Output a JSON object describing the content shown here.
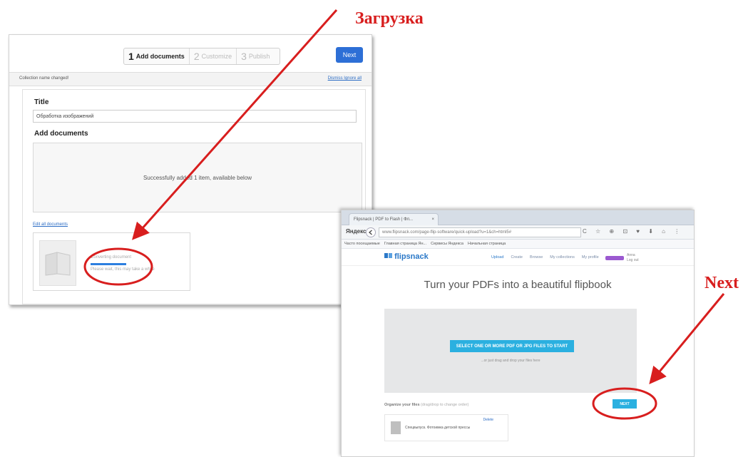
{
  "annotations": {
    "upload_label": "Загрузка",
    "next_label": "Next",
    "color": "#d81e1e"
  },
  "left_app": {
    "steps": [
      {
        "number": "1",
        "label": "Add documents"
      },
      {
        "number": "2",
        "label": "Customize"
      },
      {
        "number": "3",
        "label": "Publish"
      }
    ],
    "next_button": "Next",
    "notice": "Collection name changed!",
    "notice_links": "Dismiss  Ignore all",
    "title_heading": "Title",
    "title_value": "Обработка изображений",
    "add_documents_heading": "Add documents",
    "dropzone_message": "Successfully added 1 item, available below",
    "edit_all_link": "Edit all documents",
    "document": {
      "name": "Converting document",
      "status": "Please wait, this may take a while",
      "progress_fraction": 0.5
    },
    "accent_color": "#2d6fd6"
  },
  "right_app": {
    "browser_tab_title": "Flipsnack | PDF to Flash | Фл...",
    "browser_tab_close": "×",
    "browser_logo": "Яндекс",
    "back_icon": "back-arrow-icon",
    "address": "www.flipsnack.com/page-flip-software/quick-upload?u=1&ch=html5#",
    "nav_icons": "C ☆ ⊕ ⊡ ♥ ⬇ ⌂ ⋮",
    "bookmarks": [
      "Часто посещаемые",
      "Главная страница Ян...",
      "Сервисы Яндекса",
      "Начальная страница"
    ],
    "logo": "flipsnack",
    "menu": [
      "Upload",
      "Create",
      "Browse",
      "My collections",
      "My profile"
    ],
    "user": {
      "name": "Anna",
      "action": "Log out"
    },
    "hero": "Turn your PDFs into a beautiful flipbook",
    "select_button": "SELECT ONE OR MORE PDF OR JPG FILES TO START",
    "drop_hint": "...or just drag and drop your files here",
    "organize": "Organize your files",
    "organize_hint": "(drag/drop to change order)",
    "next_button": "NEXT",
    "file": {
      "name": "Спецвыпуск. Фотоимка детской прессы",
      "delete": "Delete"
    },
    "accent_color": "#2bb0e0"
  }
}
